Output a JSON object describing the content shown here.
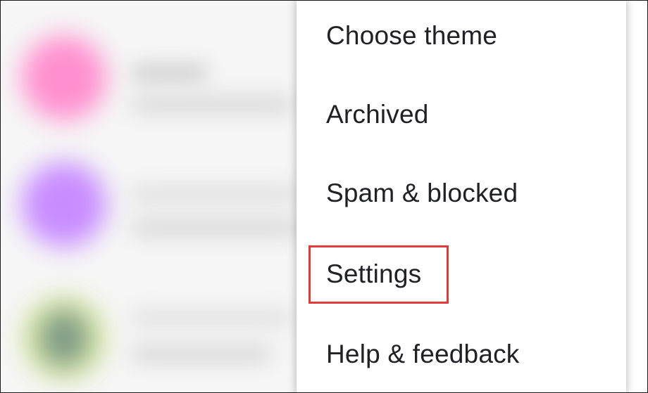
{
  "menu": {
    "items": [
      {
        "label": "Choose theme"
      },
      {
        "label": "Archived"
      },
      {
        "label": "Spam & blocked"
      },
      {
        "label": "Settings"
      },
      {
        "label": "Help & feedback"
      }
    ]
  },
  "annotation": {
    "highlighted_item": "Settings",
    "color": "#e03a3a"
  },
  "background_list": {
    "avatar_colors": [
      "#ff8fd0",
      "#c88cff",
      "#d9e8a8"
    ]
  }
}
